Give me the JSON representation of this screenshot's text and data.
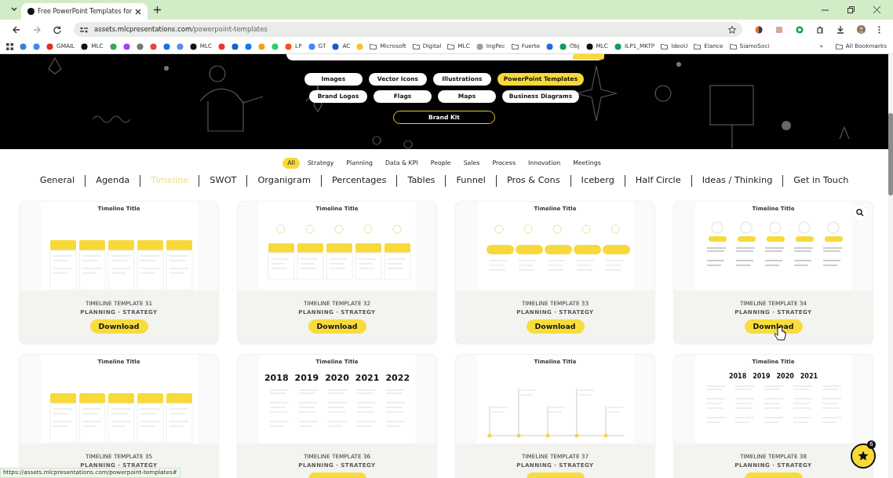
{
  "browser": {
    "tab": {
      "title": "Free PowerPoint Templates for "
    },
    "url": {
      "host": "assets.mlcpresentations.com",
      "path": "/powerpoint-templates"
    },
    "bookmarks": [
      {
        "kind": "site",
        "color": "#3b82d6"
      },
      {
        "kind": "site",
        "color": "#4285f4"
      },
      {
        "kind": "site",
        "label": "GMAIL",
        "color": "#d93025"
      },
      {
        "kind": "site",
        "label": "MLC",
        "color": "#111111"
      },
      {
        "kind": "site",
        "color": "#34a853"
      },
      {
        "kind": "site",
        "color": "#a142f4"
      },
      {
        "kind": "site",
        "color": "#777777"
      },
      {
        "kind": "site",
        "color": "#e8453c"
      },
      {
        "kind": "site",
        "color": "#1a73e8"
      },
      {
        "kind": "site",
        "color": "#5b8def"
      },
      {
        "kind": "site",
        "label": "MLC",
        "color": "#111111"
      },
      {
        "kind": "site",
        "color": "#e53935"
      },
      {
        "kind": "site",
        "color": "#0a66c2"
      },
      {
        "kind": "site",
        "color": "#1877f2"
      },
      {
        "kind": "site",
        "color": "#f4a11a"
      },
      {
        "kind": "site",
        "color": "#25d366"
      },
      {
        "kind": "site",
        "label": "LP",
        "color": "#f4511e"
      },
      {
        "kind": "site",
        "label": "GT",
        "color": "#4285f4"
      },
      {
        "kind": "site",
        "label": "AC",
        "color": "#1a56db"
      },
      {
        "kind": "site",
        "color": "#fbc02d"
      },
      {
        "kind": "folder",
        "label": "Microsoft"
      },
      {
        "kind": "folder",
        "label": "Digital"
      },
      {
        "kind": "folder",
        "label": "MLC"
      },
      {
        "kind": "site",
        "label": "IngPec",
        "color": "#9e9e9e"
      },
      {
        "kind": "folder",
        "label": "Fuerte"
      },
      {
        "kind": "site",
        "color": "#1e6fd9"
      },
      {
        "kind": "site",
        "label": "Obj",
        "color": "#0f9d58"
      },
      {
        "kind": "site",
        "label": "MLC",
        "color": "#111111"
      },
      {
        "kind": "site",
        "label": "ILP1_MKTP",
        "color": "#0f9d58"
      },
      {
        "kind": "folder",
        "label": "IdeoU"
      },
      {
        "kind": "folder",
        "label": "Elance"
      },
      {
        "kind": "folder",
        "label": "SiamoSoci"
      }
    ],
    "more": "»",
    "all_bookmarks": "All Bookmarks",
    "status_url": "https://assets.mlcpresentations.com/powerpoint-templates#"
  },
  "categories": [
    {
      "label": "Images",
      "selected": false
    },
    {
      "label": "Vector Icons",
      "selected": false
    },
    {
      "label": "Illustrations",
      "selected": false
    },
    {
      "label": "PowerPoint Templates",
      "selected": true
    },
    {
      "label": "Brand Logos",
      "selected": false
    },
    {
      "label": "Flags",
      "selected": false
    },
    {
      "label": "Maps",
      "selected": false
    },
    {
      "label": "Business Diagrams",
      "selected": false
    }
  ],
  "brand_kit": "Brand Kit",
  "filters": [
    {
      "label": "All",
      "selected": true
    },
    {
      "label": "Strategy",
      "selected": false
    },
    {
      "label": "Planning",
      "selected": false
    },
    {
      "label": "Data & KPI",
      "selected": false
    },
    {
      "label": "People",
      "selected": false
    },
    {
      "label": "Sales",
      "selected": false
    },
    {
      "label": "Process",
      "selected": false
    },
    {
      "label": "Innovation",
      "selected": false
    },
    {
      "label": "Meetings",
      "selected": false
    }
  ],
  "sections": [
    {
      "label": "General",
      "selected": false
    },
    {
      "label": "Agenda",
      "selected": false
    },
    {
      "label": "Timeline",
      "selected": true
    },
    {
      "label": "SWOT",
      "selected": false
    },
    {
      "label": "Organigram",
      "selected": false
    },
    {
      "label": "Percentages",
      "selected": false
    },
    {
      "label": "Tables",
      "selected": false
    },
    {
      "label": "Funnel",
      "selected": false
    },
    {
      "label": "Pros & Cons",
      "selected": false
    },
    {
      "label": "Iceberg",
      "selected": false
    },
    {
      "label": "Half Circle",
      "selected": false
    },
    {
      "label": "Ideas / Thinking",
      "selected": false
    },
    {
      "label": "Get in Touch",
      "selected": false
    }
  ],
  "templates": [
    {
      "title": "TIMELINE TEMPLATE 31",
      "tags": "PLANNING · STRATEGY",
      "button": "Download",
      "hovered": false,
      "preview": {
        "kind": "boxes",
        "title": "Timeline Title"
      }
    },
    {
      "title": "TIMELINE TEMPLATE 32",
      "tags": "PLANNING · STRATEGY",
      "button": "Download",
      "hovered": false,
      "preview": {
        "kind": "circles",
        "title": "Timeline Title"
      }
    },
    {
      "title": "TIMELINE TEMPLATE 33",
      "tags": "PLANNING · STRATEGY",
      "button": "Download",
      "hovered": false,
      "preview": {
        "kind": "pills",
        "title": "Timeline Title"
      }
    },
    {
      "title": "TIMELINE TEMPLATE 34",
      "tags": "PLANNING · STRATEGY",
      "button": "Download",
      "hovered": true,
      "preview": {
        "kind": "badges",
        "title": "Timeline Title"
      }
    },
    {
      "title": "TIMELINE TEMPLATE 35",
      "tags": "PLANNING · STRATEGY",
      "hovered": false,
      "button_peek": false,
      "preview": {
        "kind": "boxes",
        "title": "Timeline Title"
      }
    },
    {
      "title": "TIMELINE TEMPLATE 36",
      "tags": "PLANNING · STRATEGY",
      "hovered": false,
      "button_peek": true,
      "preview": {
        "kind": "years",
        "title": "Timeline Title",
        "years": [
          "2018",
          "2019",
          "2020",
          "2021",
          "2022"
        ]
      }
    },
    {
      "title": "TIMELINE TEMPLATE 37",
      "tags": "PLANNING · STRATEGY",
      "hovered": false,
      "button_peek": true,
      "preview": {
        "kind": "zigzag",
        "title": "Timeline Title"
      }
    },
    {
      "title": "TIMELINE TEMPLATE 38",
      "tags": "PLANNING · STRATEGY",
      "hovered": false,
      "button_peek": true,
      "preview": {
        "kind": "years",
        "title": "Timeline Title",
        "years": [
          "2018",
          "2019",
          "2020",
          "2021"
        ]
      }
    }
  ],
  "favorites": {
    "count": "6"
  }
}
